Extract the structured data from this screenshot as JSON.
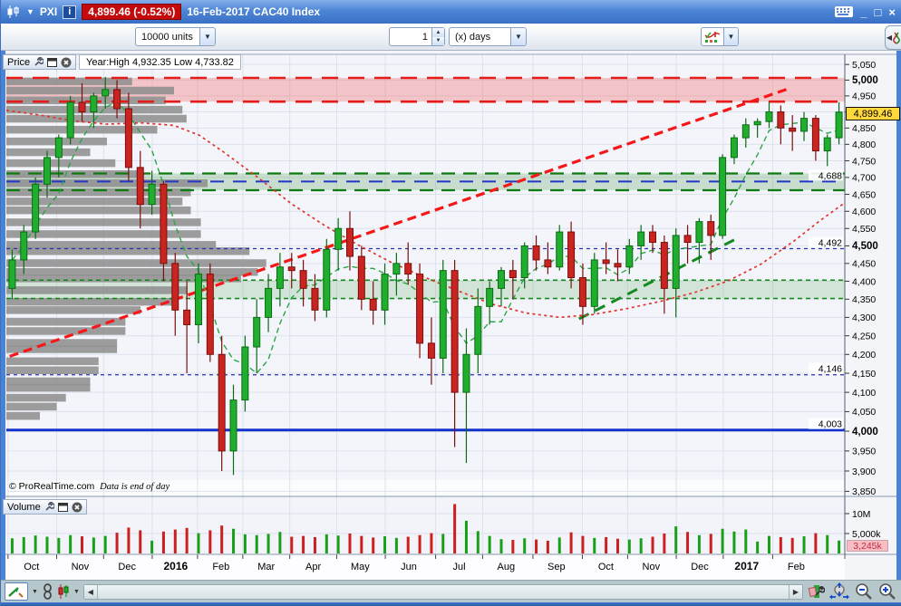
{
  "window": {
    "symbol": "PXI",
    "price_badge": "4,899.46 (-0.52%)",
    "title": "16-Feb-2017 CAC40 Index",
    "minimize": "_",
    "maximize": "□",
    "close": "×"
  },
  "toolbar": {
    "units_dropdown": "10000 units",
    "interval_value": "1",
    "interval_dropdown": "(x) days"
  },
  "price_pane": {
    "label": "Price",
    "year_info": "Year:High 4,932.35 Low 4,733.82",
    "copyright": "© ProRealTime.com",
    "data_note": "Data is end of day",
    "last_label": "4,899.46"
  },
  "volume_pane": {
    "label": "Volume",
    "current_label": "3,245k"
  },
  "palette": {
    "up": "#1fae2e",
    "up_border": "#0c6b14",
    "down": "#c9241f",
    "down_border": "#7a100d",
    "profile": "#909090",
    "grid": "#dde1ec",
    "axis_text": "#000000",
    "pane_bg": "#f3f5fb",
    "axis_bg": "#f4f5f9",
    "frame_blue": "#4a82d4"
  },
  "chart_data": {
    "type": "candlestick",
    "instrument": "CAC40 Index",
    "date": "16-Feb-2017",
    "last": 4899.46,
    "change_pct": -0.52,
    "year_high": 4932.35,
    "year_low": 4733.82,
    "scale": "log",
    "price_axis": {
      "min": 3842,
      "max": 5065,
      "tick_step": 50,
      "first_tick": 3850,
      "last_tick": 5050,
      "bold_ticks": [
        4000,
        4500,
        5000
      ],
      "hidden_tick": 4900
    },
    "x_axis": {
      "labels": [
        {
          "text": "Oct",
          "frac": 0.03,
          "bold": false
        },
        {
          "text": "Nov",
          "frac": 0.088,
          "bold": false
        },
        {
          "text": "Dec",
          "frac": 0.144,
          "bold": false
        },
        {
          "text": "2016",
          "frac": 0.202,
          "bold": true
        },
        {
          "text": "Feb",
          "frac": 0.256,
          "bold": false
        },
        {
          "text": "Mar",
          "frac": 0.31,
          "bold": false
        },
        {
          "text": "Apr",
          "frac": 0.366,
          "bold": false
        },
        {
          "text": "May",
          "frac": 0.422,
          "bold": false
        },
        {
          "text": "Jun",
          "frac": 0.48,
          "bold": false
        },
        {
          "text": "Jul",
          "frac": 0.54,
          "bold": false
        },
        {
          "text": "Aug",
          "frac": 0.596,
          "bold": false
        },
        {
          "text": "Sep",
          "frac": 0.656,
          "bold": false
        },
        {
          "text": "Oct",
          "frac": 0.715,
          "bold": false
        },
        {
          "text": "Nov",
          "frac": 0.769,
          "bold": false
        },
        {
          "text": "Dec",
          "frac": 0.827,
          "bold": false
        },
        {
          "text": "2017",
          "frac": 0.883,
          "bold": true
        },
        {
          "text": "Feb",
          "frac": 0.942,
          "bold": false
        }
      ]
    },
    "candles": [
      [
        4380,
        4490,
        4350,
        4460
      ],
      [
        4460,
        4560,
        4420,
        4540
      ],
      [
        4540,
        4700,
        4520,
        4680
      ],
      [
        4680,
        4780,
        4640,
        4760
      ],
      [
        4760,
        4830,
        4700,
        4820
      ],
      [
        4820,
        4950,
        4800,
        4930
      ],
      [
        4930,
        4990,
        4870,
        4900
      ],
      [
        4900,
        4960,
        4850,
        4950
      ],
      [
        4950,
        5010,
        4910,
        4970
      ],
      [
        4970,
        5000,
        4880,
        4910
      ],
      [
        4910,
        4960,
        4690,
        4730
      ],
      [
        4730,
        4780,
        4550,
        4620
      ],
      [
        4620,
        4720,
        4590,
        4680
      ],
      [
        4680,
        4690,
        4400,
        4450
      ],
      [
        4450,
        4480,
        4250,
        4320
      ],
      [
        4320,
        4400,
        4150,
        4280
      ],
      [
        4280,
        4450,
        4230,
        4420
      ],
      [
        4420,
        4450,
        4180,
        4200
      ],
      [
        4200,
        4250,
        3900,
        3950
      ],
      [
        3950,
        4120,
        3890,
        4080
      ],
      [
        4080,
        4250,
        4050,
        4220
      ],
      [
        4220,
        4350,
        4150,
        4300
      ],
      [
        4300,
        4420,
        4260,
        4380
      ],
      [
        4380,
        4480,
        4330,
        4440
      ],
      [
        4440,
        4480,
        4380,
        4430
      ],
      [
        4430,
        4460,
        4330,
        4380
      ],
      [
        4380,
        4420,
        4290,
        4320
      ],
      [
        4320,
        4520,
        4300,
        4490
      ],
      [
        4490,
        4580,
        4430,
        4550
      ],
      [
        4550,
        4600,
        4430,
        4470
      ],
      [
        4470,
        4500,
        4320,
        4350
      ],
      [
        4350,
        4400,
        4280,
        4320
      ],
      [
        4320,
        4450,
        4280,
        4420
      ],
      [
        4420,
        4480,
        4360,
        4450
      ],
      [
        4450,
        4510,
        4390,
        4420
      ],
      [
        4420,
        4450,
        4190,
        4230
      ],
      [
        4230,
        4300,
        4120,
        4190
      ],
      [
        4190,
        4460,
        4150,
        4430
      ],
      [
        4430,
        4460,
        3960,
        4100
      ],
      [
        4100,
        4270,
        3920,
        4200
      ],
      [
        4200,
        4380,
        4150,
        4330
      ],
      [
        4330,
        4400,
        4280,
        4380
      ],
      [
        4380,
        4440,
        4330,
        4430
      ],
      [
        4430,
        4460,
        4350,
        4410
      ],
      [
        4410,
        4510,
        4380,
        4500
      ],
      [
        4500,
        4530,
        4430,
        4460
      ],
      [
        4460,
        4510,
        4420,
        4440
      ],
      [
        4440,
        4560,
        4430,
        4540
      ],
      [
        4540,
        4570,
        4380,
        4410
      ],
      [
        4410,
        4450,
        4280,
        4330
      ],
      [
        4330,
        4480,
        4310,
        4460
      ],
      [
        4460,
        4510,
        4420,
        4450
      ],
      [
        4450,
        4490,
        4400,
        4440
      ],
      [
        4440,
        4520,
        4420,
        4500
      ],
      [
        4500,
        4560,
        4460,
        4540
      ],
      [
        4540,
        4560,
        4480,
        4510
      ],
      [
        4510,
        4530,
        4310,
        4380
      ],
      [
        4380,
        4550,
        4300,
        4530
      ],
      [
        4530,
        4560,
        4450,
        4510
      ],
      [
        4510,
        4580,
        4450,
        4570
      ],
      [
        4570,
        4590,
        4460,
        4530
      ],
      [
        4530,
        4770,
        4520,
        4760
      ],
      [
        4760,
        4830,
        4740,
        4820
      ],
      [
        4820,
        4880,
        4790,
        4860
      ],
      [
        4860,
        4880,
        4820,
        4870
      ],
      [
        4870,
        4932,
        4850,
        4900
      ],
      [
        4900,
        4920,
        4800,
        4850
      ],
      [
        4850,
        4890,
        4780,
        4840
      ],
      [
        4840,
        4900,
        4810,
        4880
      ],
      [
        4880,
        4890,
        4750,
        4780
      ],
      [
        4780,
        4830,
        4734,
        4820
      ],
      [
        4820,
        4930,
        4800,
        4899.46
      ]
    ],
    "volumes_millions": [
      3.8,
      4.1,
      4.5,
      4.2,
      3.9,
      4.6,
      4.3,
      4.0,
      4.4,
      5.2,
      6.5,
      5.8,
      3.2,
      5.5,
      6.0,
      6.4,
      5.1,
      5.8,
      7.0,
      6.2,
      4.8,
      4.6,
      4.9,
      5.4,
      4.2,
      4.4,
      4.1,
      4.8,
      4.5,
      5.0,
      4.4,
      4.0,
      4.3,
      3.9,
      4.2,
      4.6,
      5.1,
      4.9,
      12.4,
      8.2,
      5.6,
      4.4,
      3.6,
      3.4,
      3.8,
      3.5,
      3.2,
      4.0,
      5.3,
      4.4,
      3.9,
      4.1,
      3.7,
      3.5,
      3.8,
      4.2,
      5.0,
      6.8,
      5.4,
      4.6,
      4.9,
      6.2,
      5.5,
      6.0,
      3.0,
      4.4,
      4.1,
      3.9,
      4.3,
      5.1,
      4.6,
      3.245
    ],
    "volume_axis": {
      "labels": [
        {
          "text": "10M",
          "value": 10
        },
        {
          "text": "5,000k",
          "value": 5
        }
      ],
      "current": 3.245
    },
    "zones": [
      {
        "from": 4932,
        "to": 5007,
        "color": "rgba(242,98,98,0.33)"
      },
      {
        "from": 4662,
        "to": 4712,
        "color": "rgba(70,150,70,0.25)"
      },
      {
        "from": 4352,
        "to": 4403,
        "color": "rgba(80,160,80,0.20)"
      }
    ],
    "levels": [
      {
        "price": 5007,
        "color": "#e41b17",
        "dash": "18,11",
        "width": 2.6,
        "label": ""
      },
      {
        "price": 4932,
        "color": "#e41b17",
        "dash": "18,11",
        "width": 2.6,
        "label": ""
      },
      {
        "price": 4712,
        "color": "#0e7a12",
        "dash": "15,9",
        "width": 2.2,
        "label": ""
      },
      {
        "price": 4688,
        "color": "#2236c8",
        "dash": "15,10",
        "width": 2,
        "label": "4,688"
      },
      {
        "price": 4662,
        "color": "#0e7a12",
        "dash": "15,9",
        "width": 2.2,
        "label": ""
      },
      {
        "price": 4492,
        "color": "#2230bb",
        "dash": "4,4",
        "width": 1.3,
        "label": "4,492"
      },
      {
        "price": 4403,
        "color": "#0e8a12",
        "dash": "5,4",
        "width": 1.5,
        "label": ""
      },
      {
        "price": 4352,
        "color": "#0e8a12",
        "dash": "5,4",
        "width": 1.5,
        "label": ""
      },
      {
        "price": 4146,
        "color": "#2230bb",
        "dash": "4,4",
        "width": 1.3,
        "label": "4,146"
      },
      {
        "price": 4003,
        "color": "#1531cc",
        "dash": "",
        "width": 3,
        "label": "4,003"
      }
    ],
    "trendlines": [
      {
        "x1": 0.004,
        "p1": 4195,
        "x2": 0.932,
        "p2": 4972,
        "color": "#f61818",
        "dash": "10,6",
        "width": 3.2
      },
      {
        "x1": 0.683,
        "p1": 4296,
        "x2": 0.872,
        "p2": 4522,
        "color": "#128a1e",
        "dash": "12,8",
        "width": 3
      }
    ],
    "ma_red_points": [
      [
        0,
        4905
      ],
      [
        0.04,
        4890
      ],
      [
        0.08,
        4872
      ],
      [
        0.12,
        4862
      ],
      [
        0.16,
        4866
      ],
      [
        0.2,
        4858
      ],
      [
        0.23,
        4828
      ],
      [
        0.26,
        4775
      ],
      [
        0.3,
        4700
      ],
      [
        0.34,
        4622
      ],
      [
        0.38,
        4558
      ],
      [
        0.42,
        4502
      ],
      [
        0.46,
        4452
      ],
      [
        0.5,
        4410
      ],
      [
        0.54,
        4372
      ],
      [
        0.58,
        4336
      ],
      [
        0.62,
        4312
      ],
      [
        0.66,
        4300
      ],
      [
        0.7,
        4308
      ],
      [
        0.74,
        4324
      ],
      [
        0.78,
        4344
      ],
      [
        0.82,
        4368
      ],
      [
        0.86,
        4400
      ],
      [
        0.9,
        4448
      ],
      [
        0.94,
        4515
      ],
      [
        0.97,
        4572
      ],
      [
        1.0,
        4625
      ]
    ],
    "ma_green_window": 5,
    "volume_profile": [
      [
        4996,
        0.15
      ],
      [
        4967,
        0.2
      ],
      [
        4936,
        0.19
      ],
      [
        4907,
        0.21
      ],
      [
        4879,
        0.215
      ],
      [
        4845,
        0.18
      ],
      [
        4809,
        0.12
      ],
      [
        4776,
        0.1
      ],
      [
        4743,
        0.13
      ],
      [
        4710,
        0.16
      ],
      [
        4683,
        0.24
      ],
      [
        4656,
        0.22
      ],
      [
        4629,
        0.21
      ],
      [
        4603,
        0.22
      ],
      [
        4568,
        0.232
      ],
      [
        4534,
        0.232
      ],
      [
        4503,
        0.25
      ],
      [
        4485,
        0.29
      ],
      [
        4451,
        0.31
      ],
      [
        4426,
        0.3
      ],
      [
        4408,
        0.28
      ],
      [
        4375,
        0.216
      ],
      [
        4343,
        0.2
      ],
      [
        4320,
        0.16
      ],
      [
        4288,
        0.142
      ],
      [
        4263,
        0.142
      ],
      [
        4231,
        0.132
      ],
      [
        4214,
        0.132
      ],
      [
        4182,
        0.11
      ],
      [
        4158,
        0.11
      ],
      [
        4129,
        0.1
      ],
      [
        4112,
        0.1
      ],
      [
        4086,
        0.071
      ],
      [
        4063,
        0.06
      ],
      [
        4039,
        0.04
      ]
    ]
  }
}
